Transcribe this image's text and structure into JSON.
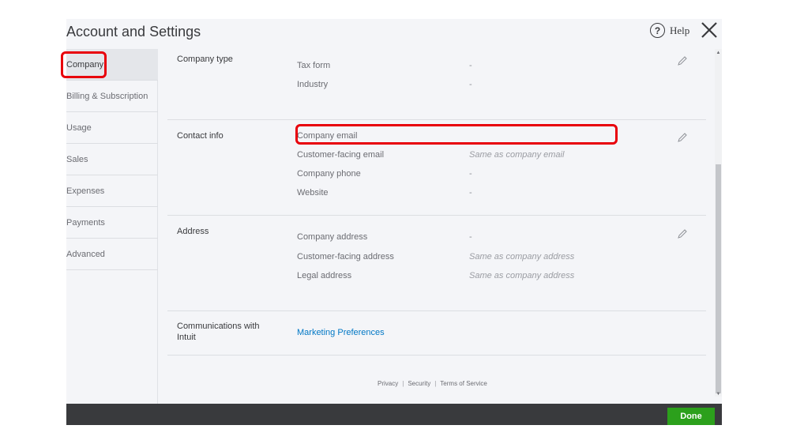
{
  "header": {
    "title": "Account and Settings",
    "help_label": "Help",
    "help_icon_glyph": "?"
  },
  "sidebar": {
    "items": [
      {
        "label": "Company",
        "active": true
      },
      {
        "label": "Billing & Subscription",
        "active": false
      },
      {
        "label": "Usage",
        "active": false
      },
      {
        "label": "Sales",
        "active": false
      },
      {
        "label": "Expenses",
        "active": false
      },
      {
        "label": "Payments",
        "active": false
      },
      {
        "label": "Advanced",
        "active": false
      }
    ]
  },
  "sections": {
    "company_type": {
      "label": "Company type",
      "fields": [
        {
          "label": "Tax form",
          "value": "-"
        },
        {
          "label": "Industry",
          "value": "-"
        }
      ]
    },
    "contact_info": {
      "label": "Contact info",
      "fields": [
        {
          "label": "Company email",
          "value": ""
        },
        {
          "label": "Customer-facing email",
          "value": "Same as company email"
        },
        {
          "label": "Company phone",
          "value": "-"
        },
        {
          "label": "Website",
          "value": "-"
        }
      ]
    },
    "address": {
      "label": "Address",
      "fields": [
        {
          "label": "Company address",
          "value": "-"
        },
        {
          "label": "Customer-facing address",
          "value": "Same as company address"
        },
        {
          "label": "Legal address",
          "value": "Same as company address"
        }
      ]
    },
    "communications": {
      "label_line1": "Communications with",
      "label_line2": "Intuit",
      "link": "Marketing Preferences"
    }
  },
  "footer": {
    "privacy": "Privacy",
    "security": "Security",
    "terms": "Terms of Service",
    "separator": "|"
  },
  "actions": {
    "done_label": "Done"
  },
  "colors": {
    "highlight": "#e8000b",
    "link": "#0077c5",
    "done": "#2ca01c",
    "bottom_bar": "#393a3d"
  }
}
